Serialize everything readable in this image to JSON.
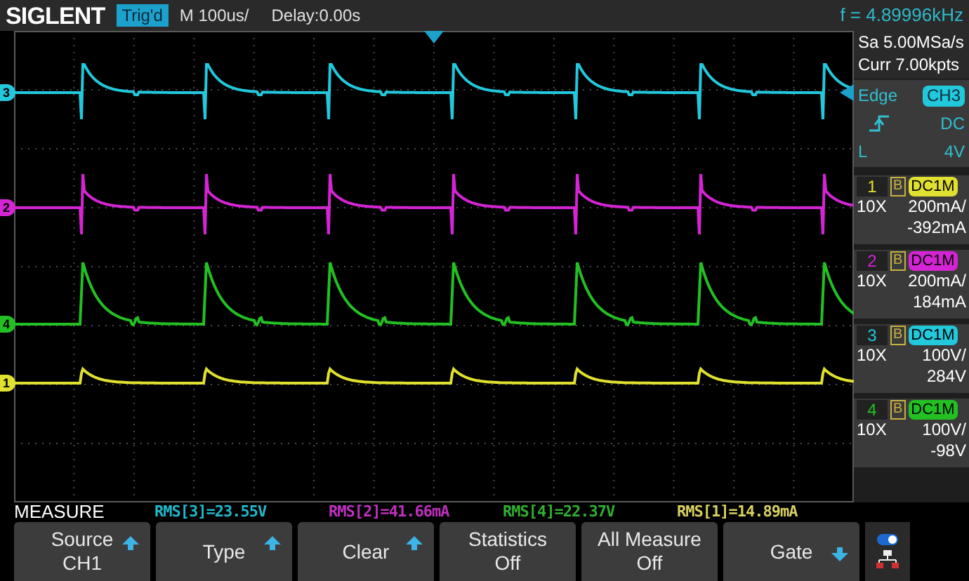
{
  "top_bar": {
    "logo": "SIGLENT",
    "trigger_status": "Trig'd",
    "timebase": "M 100us/",
    "delay": "Delay:0.00s",
    "frequency": "f = 4.89996kHz"
  },
  "acquisition": {
    "sample_rate": "Sa 5.00MSa/s",
    "memory_depth": "Curr 7.00kpts"
  },
  "trigger": {
    "type": "Edge",
    "source": "CH3",
    "coupling": "DC",
    "level_label": "L",
    "level": "4V",
    "slope": {
      "kind": "rising"
    }
  },
  "traces": [
    {
      "label": "3",
      "color": "#22c8dc",
      "kind": "cyan-step"
    },
    {
      "label": "2",
      "color": "#d424d4",
      "kind": "spike-dip"
    },
    {
      "label": "4",
      "color": "#22c022",
      "kind": "spike"
    },
    {
      "label": "1",
      "color": "#e0e030",
      "kind": "small-spike"
    }
  ],
  "channels": [
    {
      "number": "1",
      "bandwidth_limit": "B",
      "coupling": "DC1M",
      "probe": "10X",
      "scale": "200mA/",
      "offset": "-392mA",
      "color": "#e0e030"
    },
    {
      "number": "2",
      "bandwidth_limit": "B",
      "coupling": "DC1M",
      "probe": "10X",
      "scale": "200mA/",
      "offset": "184mA",
      "color": "#d424d4"
    },
    {
      "number": "3",
      "bandwidth_limit": "B",
      "coupling": "DC1M",
      "probe": "10X",
      "scale": "100V/",
      "offset": "284V",
      "color": "#22c8dc"
    },
    {
      "number": "4",
      "bandwidth_limit": "B",
      "coupling": "DC1M",
      "probe": "10X",
      "scale": "100V/",
      "offset": "-98V",
      "color": "#22c022"
    }
  ],
  "measure": {
    "title": "MEASURE",
    "readings": [
      {
        "text": "RMS[3]=23.55V",
        "color": "#22b8cc"
      },
      {
        "text": "RMS[2]=41.66mA",
        "color": "#c030c0"
      },
      {
        "text": "RMS[4]=22.37V",
        "color": "#30b030"
      },
      {
        "text": "RMS[1]=14.89mA",
        "color": "#d8d060"
      }
    ]
  },
  "softkeys": [
    {
      "line1": "Source",
      "line2": "CH1",
      "kind": "up"
    },
    {
      "line1": "Type",
      "kind": "up"
    },
    {
      "line1": "Clear",
      "kind": "up"
    },
    {
      "line1": "Statistics",
      "line2": "Off",
      "kind": "plain"
    },
    {
      "line1": "All Measure",
      "line2": "Off",
      "kind": "plain"
    },
    {
      "line1": "Gate",
      "kind": "down"
    }
  ]
}
